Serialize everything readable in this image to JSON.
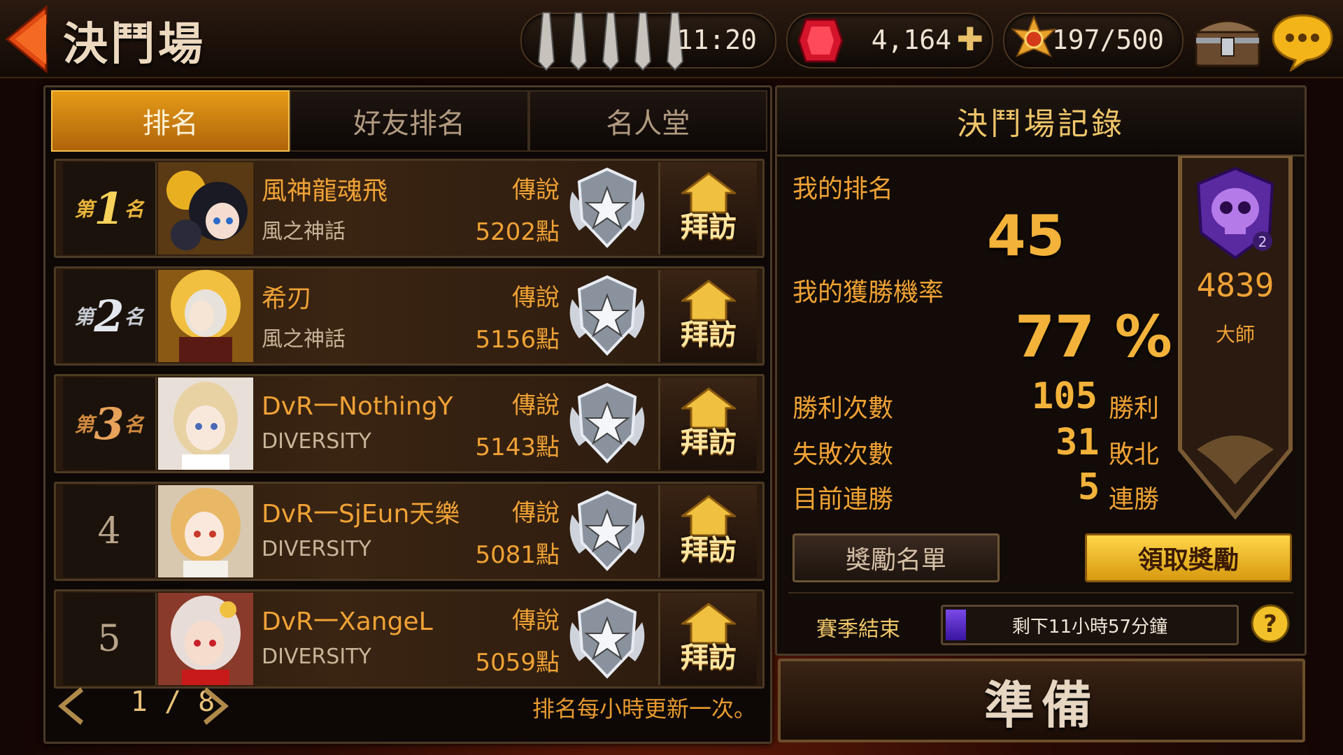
{
  "header": {
    "title": "決鬥場",
    "swords_timer": "11:20",
    "gems": "4,164",
    "medals": "197/500"
  },
  "tabs": [
    {
      "label": "排名",
      "active": true
    },
    {
      "label": "好友排名",
      "active": false
    },
    {
      "label": "名人堂",
      "active": false
    }
  ],
  "rankings": [
    {
      "rank_prefix": "第",
      "rank": "1",
      "rank_suffix": "名",
      "name": "風神龍魂飛",
      "guild": "風之神話",
      "tier": "傳說",
      "points": "5202點",
      "visit": "拜訪"
    },
    {
      "rank_prefix": "第",
      "rank": "2",
      "rank_suffix": "名",
      "name": "希刃",
      "guild": "風之神話",
      "tier": "傳說",
      "points": "5156點",
      "visit": "拜訪"
    },
    {
      "rank_prefix": "第",
      "rank": "3",
      "rank_suffix": "名",
      "name": "DvR一NothingY",
      "guild": "DIVERSITY",
      "tier": "傳說",
      "points": "5143點",
      "visit": "拜訪"
    },
    {
      "rank": "4",
      "name": "DvR一SjEun天樂",
      "guild": "DIVERSITY",
      "tier": "傳說",
      "points": "5081點",
      "visit": "拜訪"
    },
    {
      "rank": "5",
      "name": "DvR一XangeL",
      "guild": "DIVERSITY",
      "tier": "傳說",
      "points": "5059點",
      "visit": "拜訪"
    }
  ],
  "pager": {
    "page": "1 / 8",
    "note": "排名每小時更新一次。"
  },
  "record": {
    "title": "決鬥場記錄",
    "my_rank_label": "我的排名",
    "my_rank": "45",
    "win_rate_label": "我的獲勝機率",
    "win_rate": "77 %",
    "wins_label": "勝利次數",
    "wins": "105",
    "wins_unit": "勝利",
    "losses_label": "失敗次數",
    "losses": "31",
    "losses_unit": "敗北",
    "streak_label": "目前連勝",
    "streak": "5",
    "streak_unit": "連勝",
    "badge_score": "4839",
    "badge_title": "大師",
    "reward_list_button": "獎勵名單",
    "claim_button": "領取獎勵",
    "season_label": "賽季結束",
    "season_remaining": "剩下11小時57分鐘",
    "season_progress_fraction": 0.07
  },
  "ready_button": "準備",
  "colors": {
    "accent": "#f0a235",
    "active_tab": "#e59a18",
    "claim_button": "#ffd64a",
    "progress": "#5a2ec8"
  }
}
